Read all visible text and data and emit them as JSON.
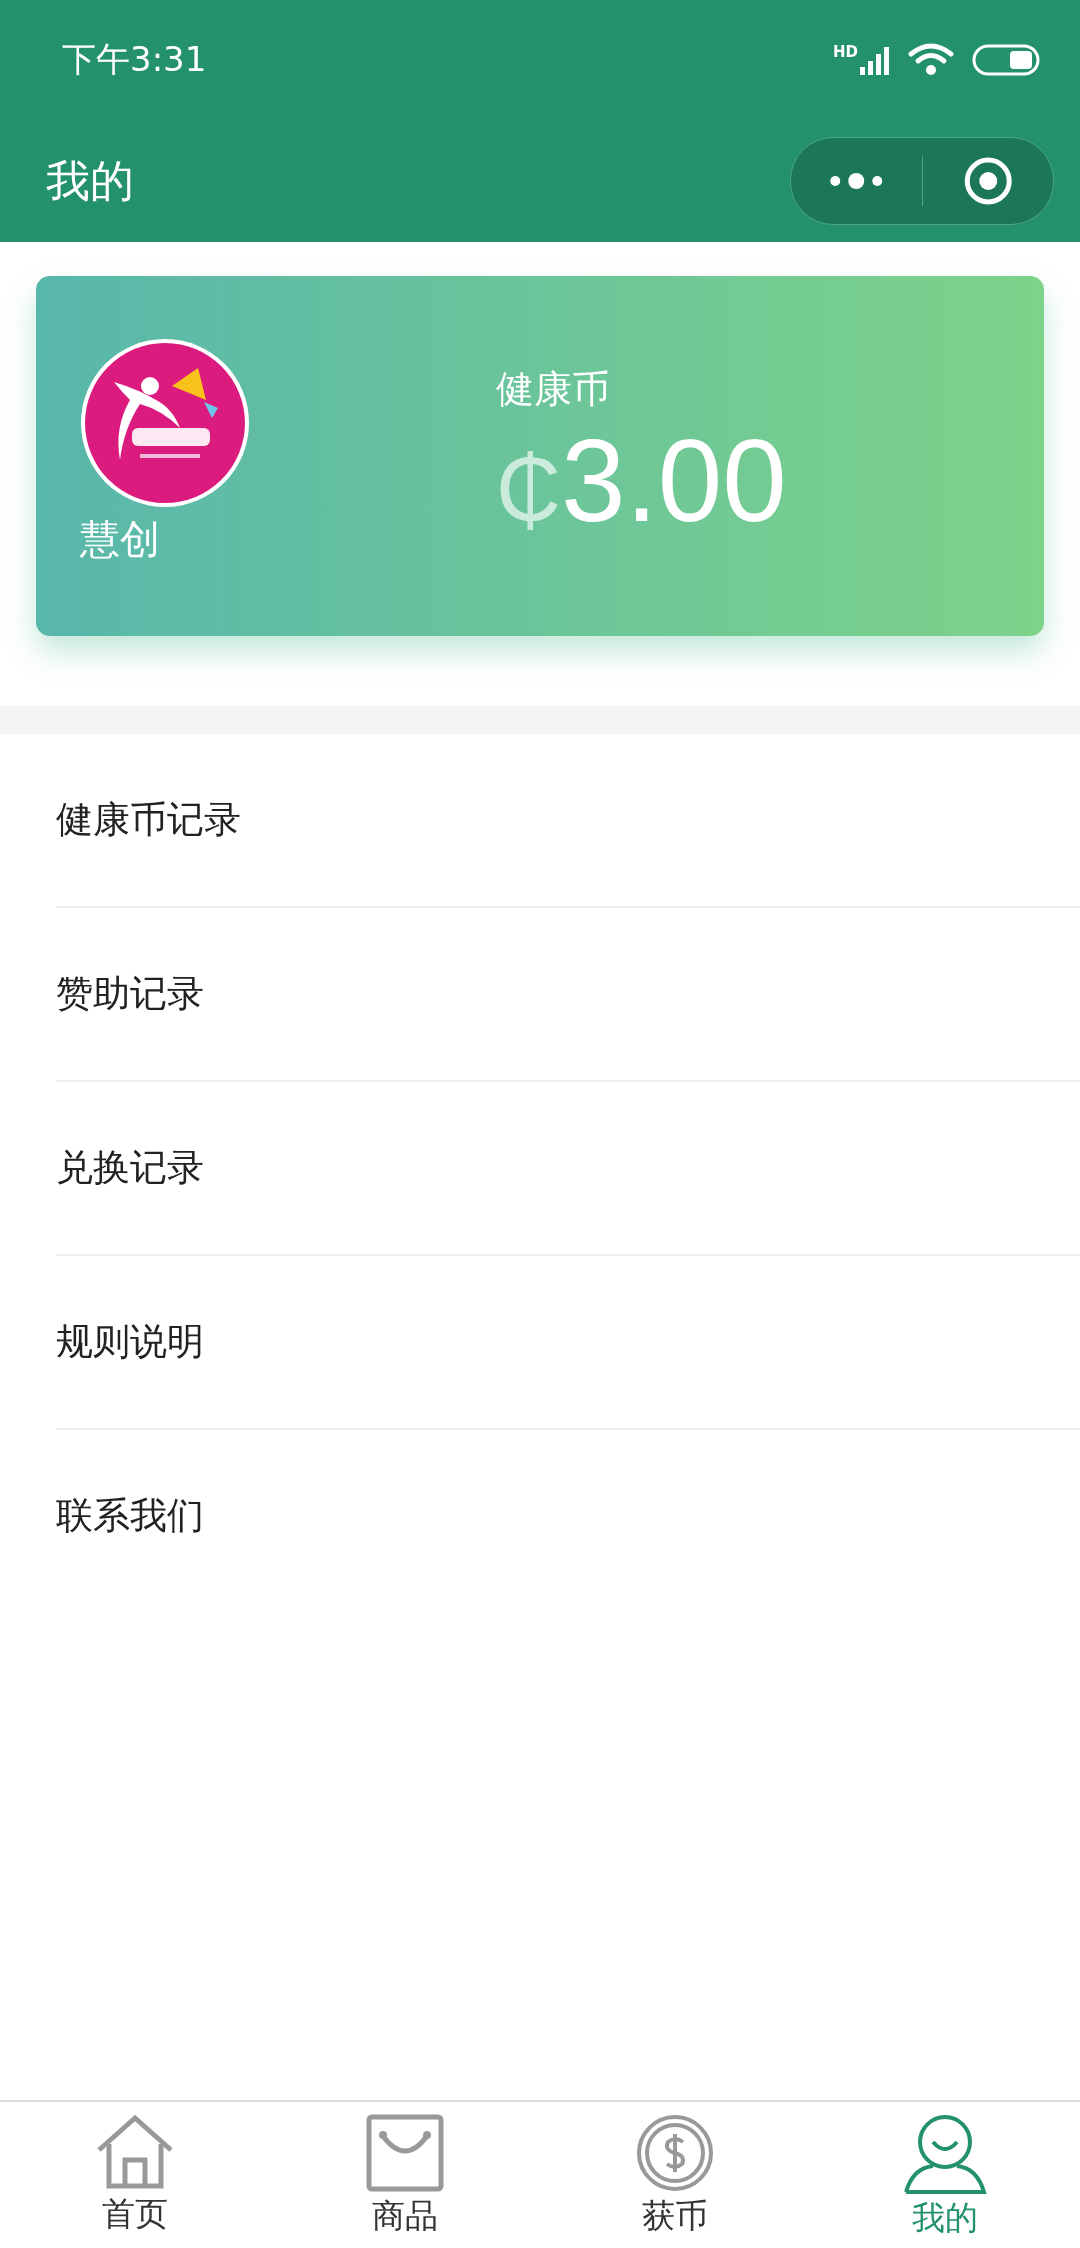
{
  "status_bar": {
    "time": "下午3:31",
    "network": "HD"
  },
  "nav_bar": {
    "title": "我的"
  },
  "card": {
    "name": "慧创",
    "balance_label": "健康币",
    "currency": "₵",
    "balance": "3.00"
  },
  "menu": [
    {
      "label": "健康币记录"
    },
    {
      "label": "赞助记录"
    },
    {
      "label": "兑换记录"
    },
    {
      "label": "规则说明"
    },
    {
      "label": "联系我们"
    }
  ],
  "tab_bar": [
    {
      "label": "首页",
      "kind": "home",
      "selected": false
    },
    {
      "label": "商品",
      "kind": "bag",
      "selected": false
    },
    {
      "label": "获币",
      "kind": "coin",
      "selected": false
    },
    {
      "label": "我的",
      "kind": "person",
      "selected": true
    }
  ]
}
